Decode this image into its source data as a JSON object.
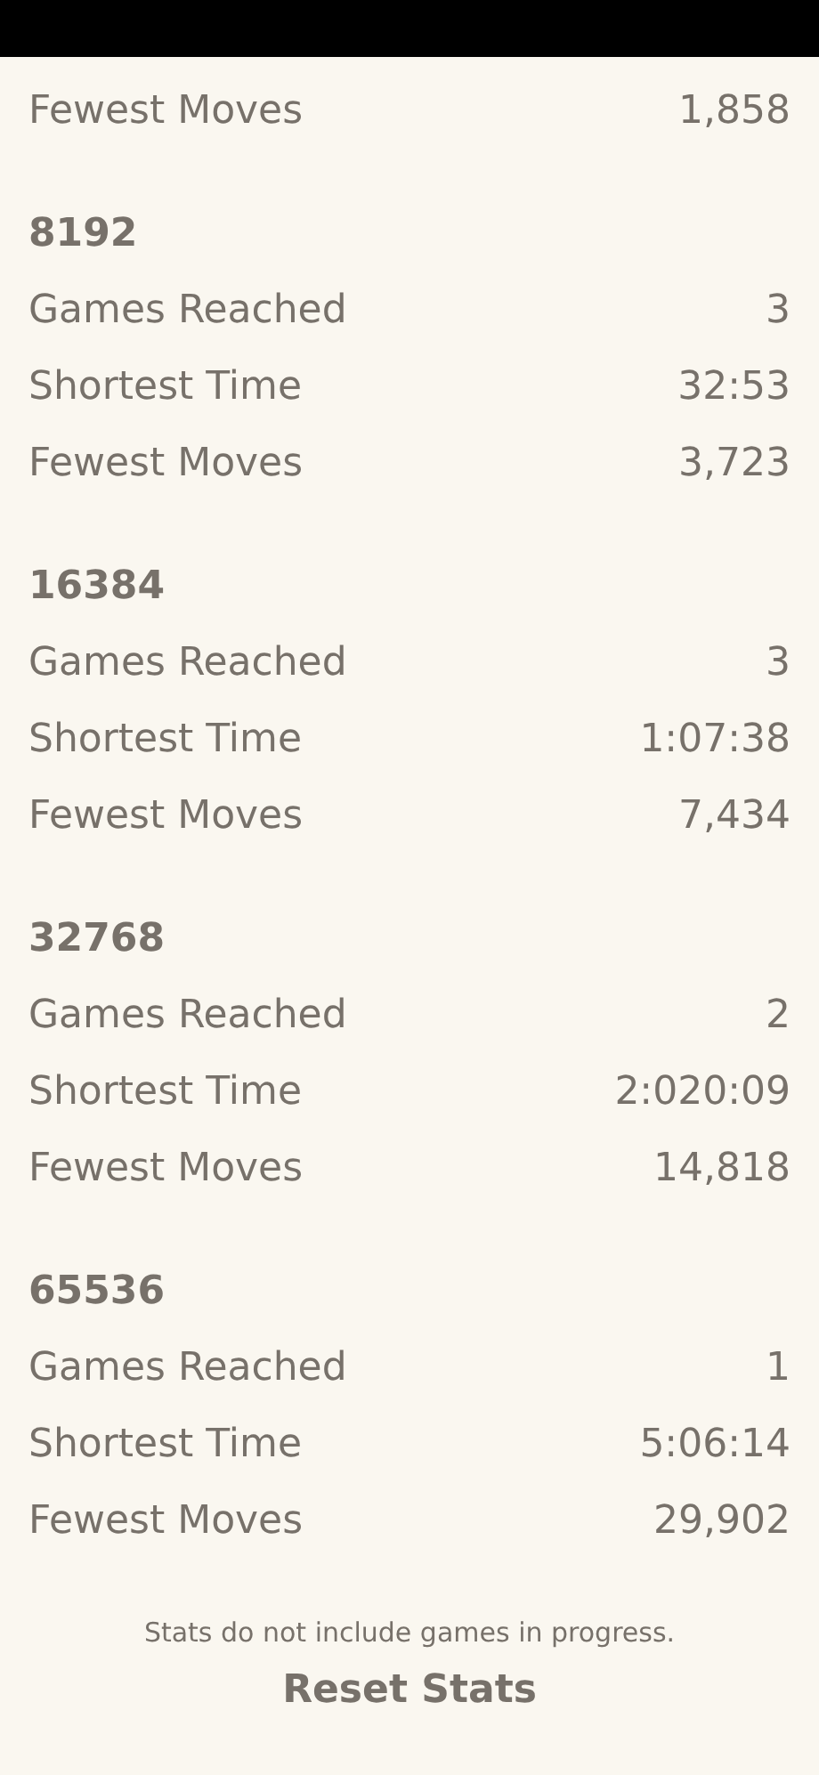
{
  "sections": [
    {
      "rows": [
        {
          "label": "Fewest Moves",
          "value": "1,858"
        }
      ]
    },
    {
      "heading": "8192",
      "rows": [
        {
          "label": "Games Reached",
          "value": "3"
        },
        {
          "label": "Shortest Time",
          "value": "32:53"
        },
        {
          "label": "Fewest Moves",
          "value": "3,723"
        }
      ]
    },
    {
      "heading": "16384",
      "rows": [
        {
          "label": "Games Reached",
          "value": "3"
        },
        {
          "label": "Shortest Time",
          "value": "1:07:38"
        },
        {
          "label": "Fewest Moves",
          "value": "7,434"
        }
      ]
    },
    {
      "heading": "32768",
      "rows": [
        {
          "label": "Games Reached",
          "value": "2"
        },
        {
          "label": "Shortest Time",
          "value": "2:020:09"
        },
        {
          "label": "Fewest Moves",
          "value": "14,818"
        }
      ]
    },
    {
      "heading": "65536",
      "rows": [
        {
          "label": "Games Reached",
          "value": "1"
        },
        {
          "label": "Shortest Time",
          "value": "5:06:14"
        },
        {
          "label": "Fewest Moves",
          "value": "29,902"
        }
      ]
    }
  ],
  "note": "Stats do not include games in progress.",
  "reset_button": "Reset Stats"
}
